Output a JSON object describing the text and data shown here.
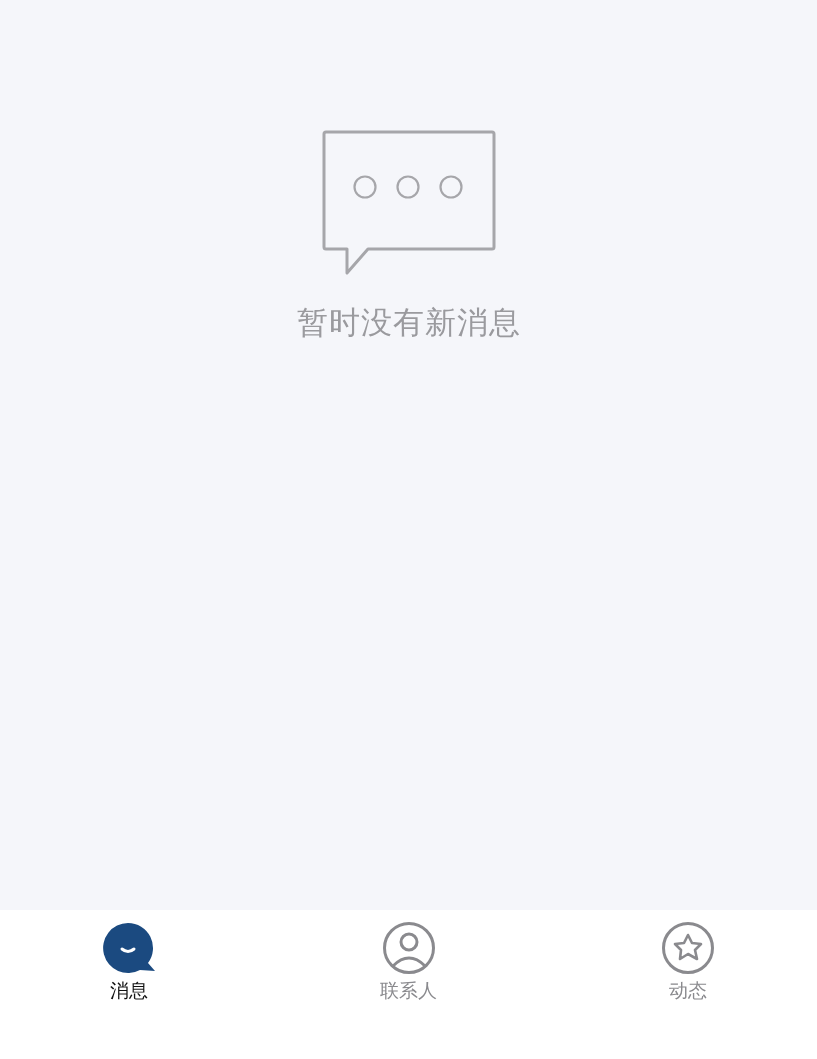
{
  "empty_state": {
    "message": "暂时没有新消息"
  },
  "tabs": [
    {
      "kind": "messages",
      "label": "消息",
      "selected": true
    },
    {
      "kind": "contacts",
      "label": "联系人",
      "selected": false
    },
    {
      "kind": "moments",
      "label": "动态",
      "selected": false
    }
  ]
}
